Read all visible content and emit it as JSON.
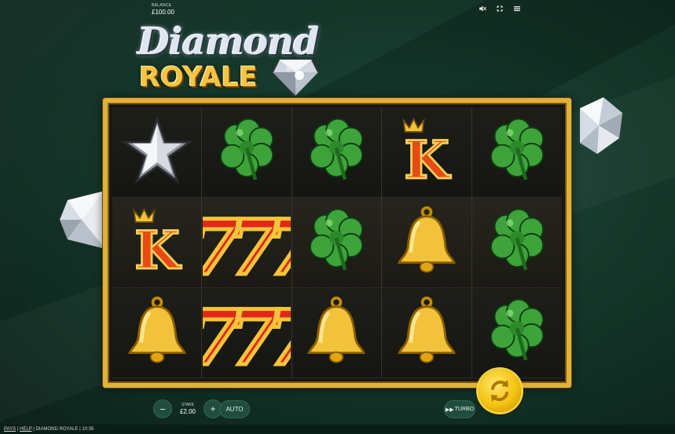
{
  "header": {
    "balance_label": "BALANCE",
    "balance_value": "£100.00",
    "icons": [
      "mute-icon",
      "fullscreen-icon",
      "menu-icon"
    ]
  },
  "logo": {
    "line1": "Diamond",
    "line2": "ROYALE"
  },
  "reels": {
    "rows": [
      [
        "star",
        "clover",
        "clover",
        "king",
        "clover"
      ],
      [
        "king",
        "seven",
        "clover",
        "bell",
        "clover"
      ],
      [
        "bell",
        "seven",
        "bell",
        "bell",
        "clover"
      ]
    ]
  },
  "controls": {
    "minus_label": "−",
    "stake_label": "STAKE",
    "stake_value": "£2.00",
    "plus_label": "+",
    "auto_label": "AUTO",
    "turbo_label": "TURBO",
    "spin_icon": "spin-icon"
  },
  "footer": {
    "pays": "PAYS",
    "help": "HELP",
    "title": "DIAMOND ROYALE",
    "time": "10:35"
  },
  "colors": {
    "frame_gold": "#e0b23c",
    "button_green": "#1f4e3e",
    "spin_gold": "#f4c312"
  }
}
